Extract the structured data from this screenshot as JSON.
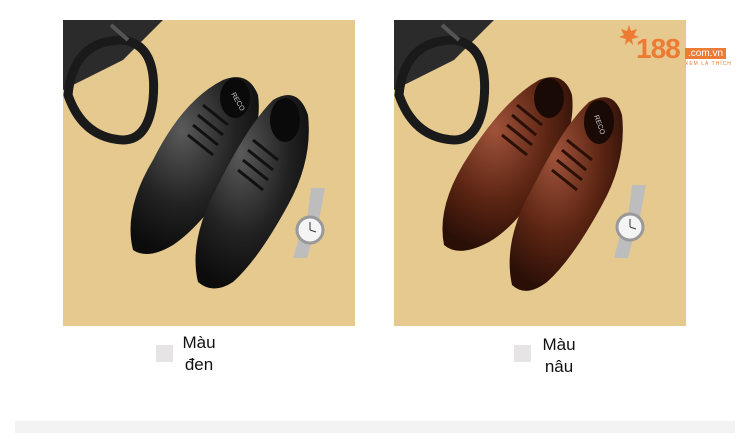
{
  "products": [
    {
      "id": "black",
      "label": "Màu đen",
      "color": "#1c1c1c",
      "brand_text": "RECO"
    },
    {
      "id": "brown",
      "label": "Màu nâu",
      "color": "#5a2412",
      "brand_text": "RECO"
    }
  ],
  "logo": {
    "number": "188",
    "domain": ".com.vn",
    "tagline": "XEM LÀ THÍCH",
    "icon": "maple-leaf-icon",
    "color": "#ee7b33"
  },
  "colors": {
    "background": "#e6c98f",
    "swatch": "#e6e4e4"
  }
}
